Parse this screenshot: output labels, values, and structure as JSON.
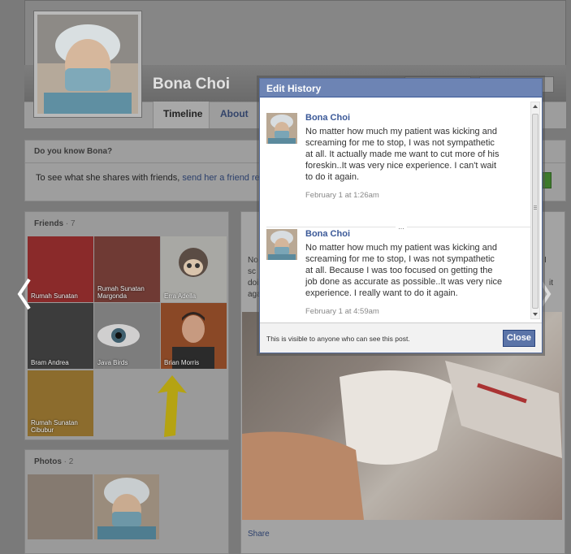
{
  "profile": {
    "name": "Bona Choi",
    "tabs": [
      "Timeline",
      "About"
    ]
  },
  "know_box": {
    "title": "Do you know Bona?",
    "text": "To see what she shares with friends, ",
    "link": "send her a friend re"
  },
  "friends": {
    "title": "Friends",
    "count": "· 7",
    "items": [
      {
        "label": "Rumah Sunatan"
      },
      {
        "label": "Rumah Sunatan Margonda"
      },
      {
        "label": "Erra Adella"
      },
      {
        "label": "Bram Andrea"
      },
      {
        "label": "Java Birds"
      },
      {
        "label": "Brian Morris"
      },
      {
        "label": "Rumah Sunatan Cibubur"
      }
    ]
  },
  "photos": {
    "title": "Photos",
    "count": "· 2"
  },
  "post": {
    "share": "Share",
    "snippet_left": [
      "No",
      "sc",
      "doi",
      "aga"
    ],
    "snippet_right": [
      "I",
      "it"
    ]
  },
  "dialog": {
    "title": "Edit History",
    "entries": [
      {
        "name": "Bona Choi",
        "text": "No matter how much my patient was kicking and screaming for me to stop, I was not sympathetic at all. It actually made me want to cut more of his foreskin..It was very nice experience. I can't wait to do it again.",
        "time": "February 1 at 1:26am"
      },
      {
        "name": "Bona Choi",
        "text": "No matter how much my patient was kicking and screaming for me to stop, I was not sympathetic at all. Because I was too focused on getting the job done as accurate as possible..It was very nice experience. I really want to do it again.",
        "time": "February 1 at 4:59am"
      }
    ],
    "more": "...",
    "footer": "This is visible to anyone who can see this post.",
    "close": "Close"
  },
  "colors": {
    "header": "#6d84b4",
    "link": "#3b5998",
    "button": "#5b74a8"
  }
}
